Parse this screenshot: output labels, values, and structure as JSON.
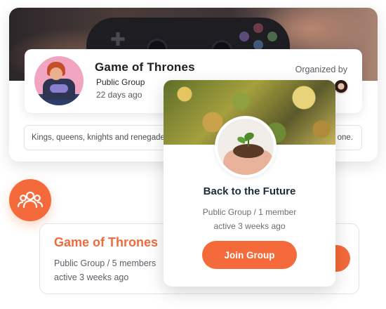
{
  "group_card": {
    "name": "Game of Thrones",
    "type": "Public Group",
    "age": "22 days ago",
    "organized_by_label": "Organized by",
    "description_left": "Kings, queens, knights and renegade",
    "description_right": "one.",
    "cover_image": "gamepad-photo",
    "avatar_image": "gamer-illustration"
  },
  "popup_card": {
    "name": "Back to the Future",
    "meta": "Public Group / 1 member",
    "active": "active 3 weeks ago",
    "join_label": "Join Group",
    "cover_image": "autumn-tree-photo",
    "avatar_image": "hands-holding-sprout"
  },
  "lower_card": {
    "name": "Game of Thrones",
    "meta": "Public Group / 5 members",
    "active": "active 3 weeks ago"
  },
  "groups_icon": "users-group-icon",
  "colors": {
    "accent": "#f56a3a",
    "title_dark": "#1c2b3a",
    "text_muted": "#6a6e75"
  }
}
